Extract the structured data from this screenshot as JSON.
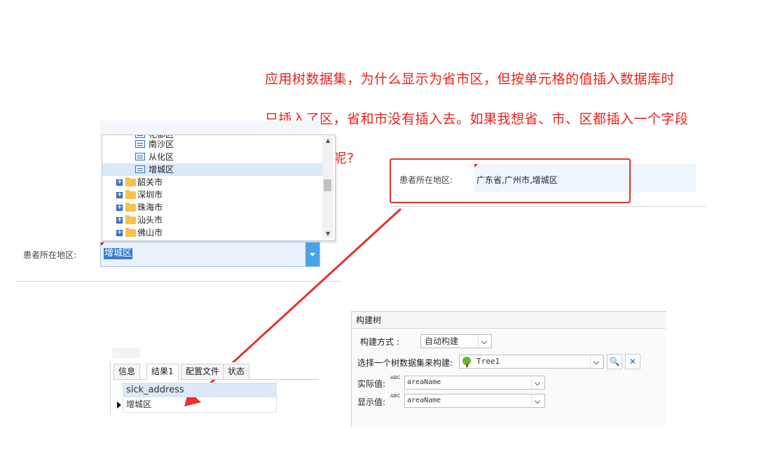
{
  "question": {
    "line1": "应用树数据集，为什么显示为省市区，但按单元格的值插入数据库时",
    "line2": "只插入了区，省和市没有插入去。如果我想省、市、区都插入一个字段",
    "line3": "要如何设置呢?"
  },
  "tree": {
    "partial_top": "花都区",
    "items": [
      {
        "label": "南沙区",
        "kind": "leaf"
      },
      {
        "label": "从化区",
        "kind": "leaf"
      },
      {
        "label": "增城区",
        "kind": "leaf",
        "selected": true
      },
      {
        "label": "韶关市",
        "kind": "folder"
      },
      {
        "label": "深圳市",
        "kind": "folder"
      },
      {
        "label": "珠海市",
        "kind": "folder"
      },
      {
        "label": "汕头市",
        "kind": "folder"
      },
      {
        "label": "佛山市",
        "kind": "folder"
      }
    ]
  },
  "left_field": {
    "label": "患者所在地区:",
    "value": "增城区"
  },
  "right_field": {
    "label": "患者所在地区:",
    "value": "广东省,广州市,增城区"
  },
  "results": {
    "tabs": [
      "信息",
      "结果1",
      "配置文件",
      "状态"
    ],
    "active_tab": "结果1",
    "column": "sick_address",
    "row_value": "增城区"
  },
  "build_tree": {
    "title": "构建树",
    "method_label": "构建方式 :",
    "method_value": "自动构建",
    "dataset_label": "选择一个树数据集来构建:",
    "dataset_value": "Tree1",
    "actual_label": "实际值:",
    "actual_value": "areaName",
    "display_label": "显示值:",
    "display_value": "areaName",
    "abc_text": "ABC"
  },
  "colors": {
    "annotation_red": "#e8231b",
    "selection_blue": "#3b7bd1",
    "combo_button": "#4aa3e8"
  }
}
